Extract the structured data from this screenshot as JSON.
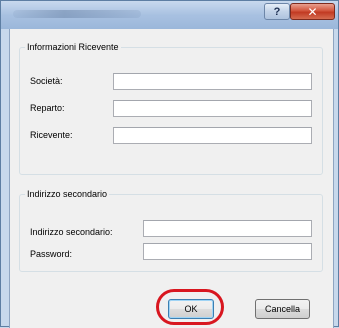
{
  "window": {
    "title": "",
    "help_label": "?",
    "close_label": "✕"
  },
  "recipient_group": {
    "title": "Informazioni Ricevente",
    "fields": [
      {
        "label": "Società:",
        "value": ""
      },
      {
        "label": "Reparto:",
        "value": ""
      },
      {
        "label": "Ricevente:",
        "value": ""
      }
    ]
  },
  "secondary_group": {
    "title": "Indirizzo secondario",
    "fields": [
      {
        "label": "Indirizzo secondario:",
        "value": ""
      },
      {
        "label": "Password:",
        "value": ""
      }
    ]
  },
  "buttons": {
    "ok_label": "OK",
    "cancel_label": "Cancella"
  },
  "colors": {
    "highlight": "#d8161f",
    "close_button": "#c23a23"
  }
}
